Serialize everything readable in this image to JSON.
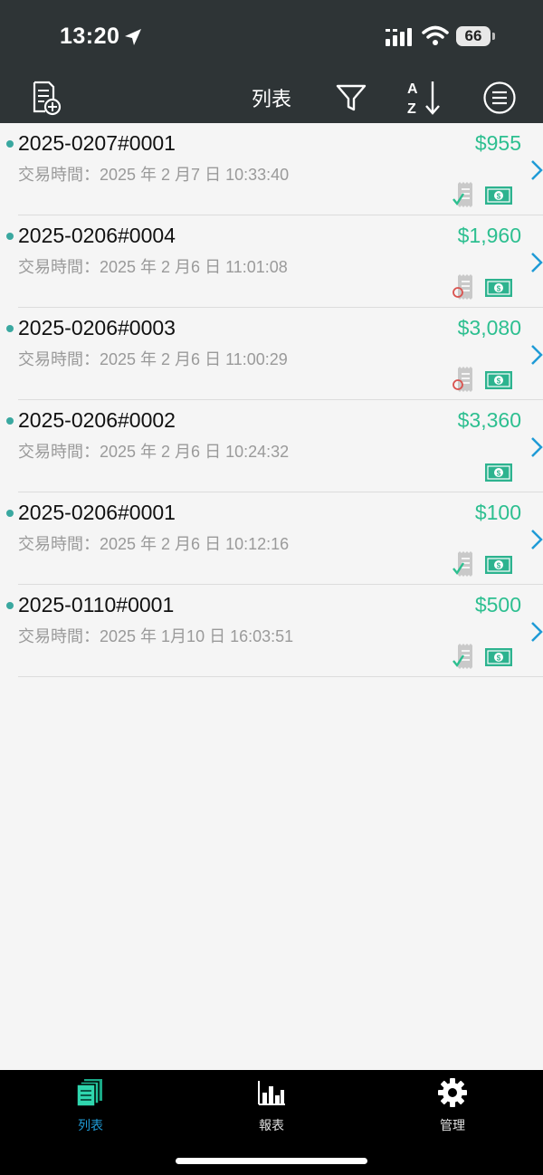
{
  "status_bar": {
    "time": "13:20",
    "battery": "66"
  },
  "nav": {
    "title": "列表"
  },
  "orders": [
    {
      "id": "2025-0207#0001",
      "amount": "$955",
      "time": "交易時間：2025 年 2 月7 日 10:33:40",
      "receipt": "check"
    },
    {
      "id": "2025-0206#0004",
      "amount": "$1,960",
      "time": "交易時間：2025 年 2 月6 日 11:01:08",
      "receipt": "circle"
    },
    {
      "id": "2025-0206#0003",
      "amount": "$3,080",
      "time": "交易時間：2025 年 2 月6 日 11:00:29",
      "receipt": "circle"
    },
    {
      "id": "2025-0206#0002",
      "amount": "$3,360",
      "time": "交易時間：2025 年 2 月6 日 10:24:32",
      "receipt": "none"
    },
    {
      "id": "2025-0206#0001",
      "amount": "$100",
      "time": "交易時間：2025 年 2 月6 日 10:12:16",
      "receipt": "check"
    },
    {
      "id": "2025-0110#0001",
      "amount": "$500",
      "time": "交易時間：2025 年 1月10 日 16:03:51",
      "receipt": "check"
    }
  ],
  "tabs": [
    {
      "label": "列表",
      "icon": "list-icon",
      "active": true
    },
    {
      "label": "報表",
      "icon": "bar-chart-icon",
      "active": false
    },
    {
      "label": "管理",
      "icon": "gear-icon",
      "active": false
    }
  ],
  "colors": {
    "header_bg": "#2e3436",
    "amount": "#2dbf90",
    "accent": "#1f9bd6",
    "dot": "#3aa8a0",
    "cash": "#2db38f"
  }
}
